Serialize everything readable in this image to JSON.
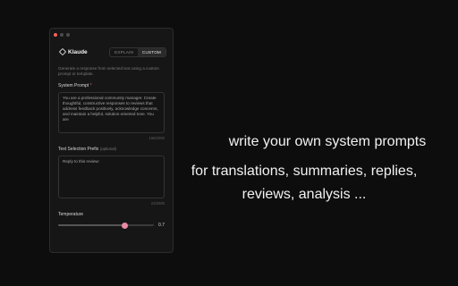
{
  "app": {
    "name": "Klaude",
    "modes": [
      {
        "label": "EXPLAIN",
        "active": false
      },
      {
        "label": "CUSTOM",
        "active": true
      }
    ],
    "description": "Generate a response from selected text using a custom prompt or template.",
    "system_prompt": {
      "label": "System Prompt",
      "required_marker": "*",
      "value": "You are a professional community manager. Create thoughtful, constructive responses to reviews that address feedback positively, acknowledge concerns, and maintain a helpful, solution-oriented tone. You are",
      "counter": "198/2000"
    },
    "text_prefix": {
      "label": "Text Selection Prefix",
      "optional_marker": "(optional)",
      "value": "Reply to this review:",
      "counter": "22/2000"
    },
    "temperature": {
      "label": "Temperature",
      "value": 0.7,
      "value_text": "0.7"
    }
  },
  "promo": {
    "line1": "write your own system prompts",
    "line2": "for translations, summaries, replies,",
    "line3": "reviews, analysis ..."
  },
  "colors": {
    "accent": "#e88aa4",
    "background": "#0d0d0d",
    "panel": "#161616"
  }
}
